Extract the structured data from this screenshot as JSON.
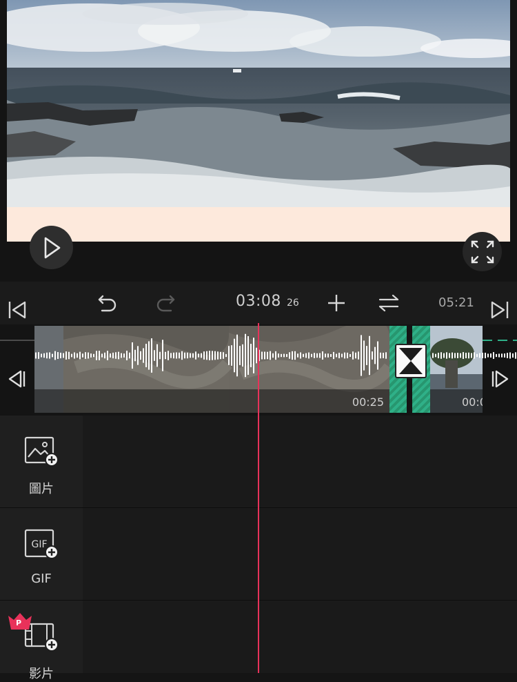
{
  "preview": {
    "play_icon": "play-icon",
    "fullscreen_icon": "fullscreen-icon"
  },
  "toolbar": {
    "timecode": "03:08",
    "frames": "26",
    "total": "05:21",
    "icons": [
      "skip-to-start-icon",
      "undo-icon",
      "redo-icon",
      "add-icon",
      "swap-icon",
      "skip-to-end-icon"
    ]
  },
  "timeline": {
    "clips": [
      {
        "duration": "00:25"
      },
      {
        "duration": "00:0"
      }
    ],
    "nav_icons": [
      "prev-frame-icon",
      "next-frame-icon"
    ],
    "transition_icon": "transition-icon"
  },
  "layers": [
    {
      "label": "圖片",
      "icon": "image-add-icon"
    },
    {
      "label": "GIF",
      "icon": "gif-add-icon",
      "icon_text": "GIF"
    },
    {
      "label": "影片",
      "icon": "video-add-icon",
      "badge": "P"
    }
  ],
  "colors": {
    "playhead": "#e8325a",
    "transition": "#2fb088",
    "pro_badge": "#e8325a",
    "canvas_bg": "#fde9dc"
  }
}
